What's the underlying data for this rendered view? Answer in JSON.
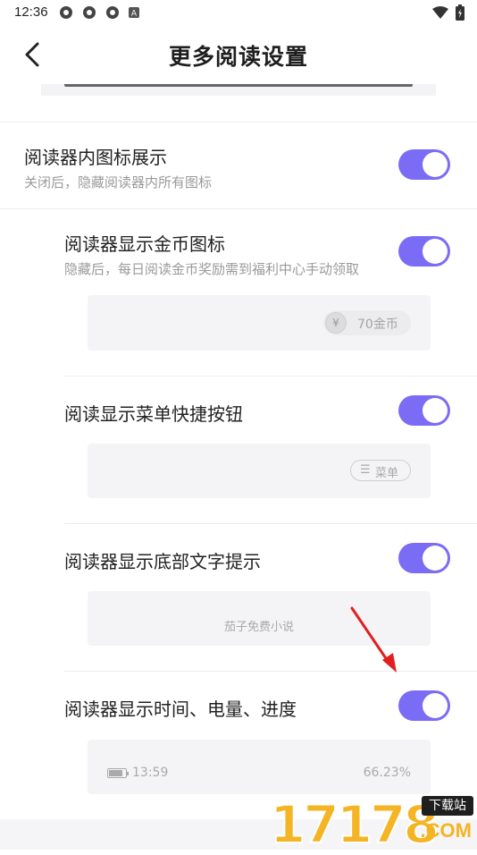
{
  "status_bar": {
    "time": "12:36",
    "left_icons": [
      "app-notification-icon",
      "app-notification-icon",
      "app-notification-icon",
      "a-badge-icon"
    ],
    "right_icons": [
      "wifi-icon",
      "battery-icon"
    ]
  },
  "header": {
    "title": "更多阅读设置",
    "back_icon": "chevron-left-icon"
  },
  "settings": [
    {
      "id": "icons",
      "label": "阅读器内图标展示",
      "desc": "关闭后，隐藏阅读器内所有图标",
      "enabled": true
    },
    {
      "id": "coin",
      "label": "阅读器显示金币图标",
      "desc": "隐藏后，每日阅读金币奖励需到福利中心手动领取",
      "enabled": true,
      "preview": {
        "coin_text": "70金币",
        "coin_symbol": "¥"
      }
    },
    {
      "id": "menu",
      "label": "阅读显示菜单快捷按钮",
      "enabled": true,
      "preview": {
        "menu_icon": "☰",
        "menu_text": "菜单"
      }
    },
    {
      "id": "bottom_text",
      "label": "阅读器显示底部文字提示",
      "enabled": true,
      "preview": {
        "hint": "茄子免费小说"
      }
    },
    {
      "id": "time_battery",
      "label": "阅读器显示时间、电量、进度",
      "enabled": true,
      "preview": {
        "time": "13:59",
        "progress": "66.23%"
      }
    }
  ],
  "colors": {
    "accent": "#7b6cf6",
    "preview_bg": "#f4f4f6",
    "arrow": "#e02020",
    "watermark": "#f4b423"
  },
  "watermark": {
    "number": "17178",
    "badge": "下载站",
    "domain": ".COM"
  }
}
